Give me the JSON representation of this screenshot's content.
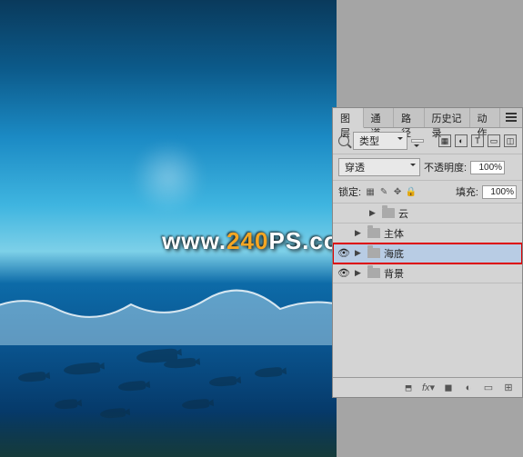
{
  "watermark": {
    "prefix": "www.",
    "num": "240",
    "suffix": "PS.com"
  },
  "panel": {
    "tabs": [
      "图层",
      "通道",
      "路径",
      "历史记录",
      "动作"
    ],
    "active_tab": 0,
    "filter": {
      "kind_label": "类型"
    },
    "blend": {
      "mode_label": "穿透",
      "opacity_label": "不透明度:",
      "opacity_value": "100%"
    },
    "lock": {
      "label": "锁定:",
      "fill_label": "填充:",
      "fill_value": "100%"
    },
    "layers": [
      {
        "name": "云",
        "visible": false,
        "selected": false,
        "highlight": false
      },
      {
        "name": "主体",
        "visible": false,
        "selected": false,
        "highlight": false
      },
      {
        "name": "海底",
        "visible": true,
        "selected": true,
        "highlight": true
      },
      {
        "name": "背景",
        "visible": true,
        "selected": false,
        "highlight": false
      }
    ]
  }
}
